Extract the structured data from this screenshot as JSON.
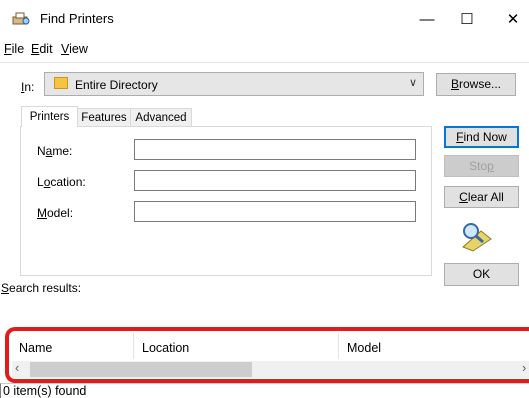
{
  "window": {
    "title": "Find Printers",
    "minimize_glyph": "—",
    "maximize_glyph": "☐",
    "close_glyph": "✕"
  },
  "menu": {
    "items": [
      {
        "label": "File",
        "accel": "F"
      },
      {
        "label": "Edit",
        "accel": "E"
      },
      {
        "label": "View",
        "accel": "V"
      }
    ]
  },
  "scope": {
    "label": "In:",
    "value": "Entire Directory",
    "browse_label": "Browse..."
  },
  "tabs": [
    {
      "label": "Printers",
      "active": true
    },
    {
      "label": "Features",
      "active": false
    },
    {
      "label": "Advanced",
      "active": false
    }
  ],
  "fields": [
    {
      "label": "Name:",
      "value": ""
    },
    {
      "label": "Location:",
      "value": ""
    },
    {
      "label": "Model:",
      "value": ""
    }
  ],
  "actions": {
    "find_now": "Find Now",
    "stop": "Stop",
    "clear_all": "Clear All",
    "ok": "OK"
  },
  "results": {
    "label": "Search results:",
    "columns": [
      "Name",
      "Location",
      "Model"
    ],
    "rows": []
  },
  "status": {
    "text": "0 item(s) found"
  },
  "colors": {
    "highlight": "#e31b1b",
    "default_button_border": "#0078d7"
  },
  "icons": {
    "app": "printer-search-icon",
    "directory": "directory-icon",
    "search_graphic": "flashlight-search-icon"
  }
}
